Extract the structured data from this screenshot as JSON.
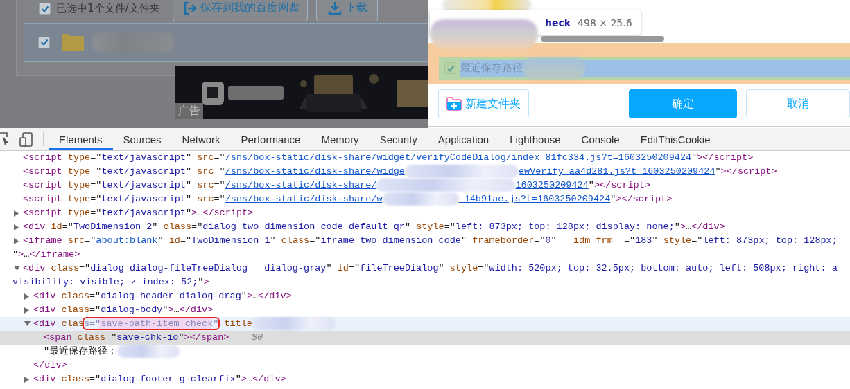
{
  "page": {
    "select_all": {
      "label": "已选中1个文件/文件夹",
      "checked": true
    },
    "buttons": [
      {
        "label": "保存到我的百度网盘",
        "kind": "save"
      },
      {
        "label": "下载",
        "kind": "download"
      }
    ],
    "files": [
      {
        "kind": "folder",
        "checked": true
      }
    ],
    "ad": {
      "kind": "picture",
      "label": "广告"
    }
  },
  "dialog": {
    "tooltip": {
      "name": "heck",
      "size": "498 × 25.6"
    },
    "save_path": {
      "label": "最近保存路径",
      "checked": true
    },
    "buttons": [
      {
        "label": "新建文件夹",
        "kind": "new-folder"
      },
      {
        "label": "确定",
        "kind": "primary"
      },
      {
        "label": "取消",
        "kind": "secondary"
      }
    ]
  },
  "devtools": {
    "tabs": [
      {
        "label": "Elements",
        "selected": true
      },
      {
        "label": "Sources",
        "selected": false
      },
      {
        "label": "Network",
        "selected": false
      },
      {
        "label": "Performance",
        "selected": false
      },
      {
        "label": "Memory",
        "selected": false
      },
      {
        "label": "Security",
        "selected": false
      },
      {
        "label": "Application",
        "selected": false
      },
      {
        "label": "Lighthouse",
        "selected": false
      },
      {
        "label": "Console",
        "selected": false
      },
      {
        "label": "EditThisCookie",
        "selected": false
      }
    ],
    "tree": [
      {
        "selected": false,
        "hovered": false,
        "lines": [
          [
            {
              "kind": "tag",
              "text": "<script"
            },
            {
              "kind": "attr",
              "text": " type"
            },
            {
              "kind": "text",
              "text": "=\""
            },
            {
              "kind": "value",
              "text": "text/javascript"
            },
            {
              "kind": "text",
              "text": "\""
            },
            {
              "kind": "attr",
              "text": " src"
            },
            {
              "kind": "text",
              "text": "=\""
            },
            {
              "kind": "link",
              "text": "/sns/box-static/disk-share/widget/verifyCodeDialog/index_81fc334.js?t=1603250209424"
            },
            {
              "kind": "text",
              "text": "\""
            },
            {
              "kind": "tag",
              "text": "></script>"
            }
          ]
        ]
      },
      {
        "selected": false,
        "hovered": false,
        "lines": [
          [
            {
              "kind": "tag",
              "text": "<script"
            },
            {
              "kind": "attr",
              "text": " type"
            },
            {
              "kind": "text",
              "text": "=\""
            },
            {
              "kind": "value",
              "text": "text/javascript"
            },
            {
              "kind": "text",
              "text": "\""
            },
            {
              "kind": "attr",
              "text": " src"
            },
            {
              "kind": "text",
              "text": "=\""
            },
            {
              "kind": "link",
              "text": "/sns/box-static/disk-share/widge"
            },
            {
              "kind": "redacted"
            },
            {
              "kind": "link",
              "text": "ewVerify_aa4d281.js?t=1603250209424"
            },
            {
              "kind": "text",
              "text": "\""
            },
            {
              "kind": "tag",
              "text": "></script>"
            }
          ]
        ]
      },
      {
        "selected": false,
        "hovered": false,
        "lines": [
          [
            {
              "kind": "tag",
              "text": "<script"
            },
            {
              "kind": "attr",
              "text": " type"
            },
            {
              "kind": "text",
              "text": "=\""
            },
            {
              "kind": "value",
              "text": "text/javascript"
            },
            {
              "kind": "text",
              "text": "\""
            },
            {
              "kind": "attr",
              "text": " src"
            },
            {
              "kind": "text",
              "text": "=\""
            },
            {
              "kind": "link",
              "text": "/sns/box-static/disk-share/"
            },
            {
              "kind": "redacted"
            },
            {
              "kind": "link",
              "text": "1603250209424"
            },
            {
              "kind": "text",
              "text": "\""
            },
            {
              "kind": "tag",
              "text": "></script>"
            }
          ]
        ]
      },
      {
        "selected": false,
        "hovered": false,
        "lines": [
          [
            {
              "kind": "tag",
              "text": "<script"
            },
            {
              "kind": "attr",
              "text": " type"
            },
            {
              "kind": "text",
              "text": "=\""
            },
            {
              "kind": "value",
              "text": "text/javascript"
            },
            {
              "kind": "text",
              "text": "\""
            },
            {
              "kind": "attr",
              "text": " src"
            },
            {
              "kind": "text",
              "text": "=\""
            },
            {
              "kind": "link",
              "text": "/sns/box-static/disk-share/w"
            },
            {
              "kind": "redacted"
            },
            {
              "kind": "link",
              "text": "_14b91ae.js?t=1603250209424"
            },
            {
              "kind": "text",
              "text": "\""
            },
            {
              "kind": "tag",
              "text": "></script>"
            }
          ]
        ]
      },
      {
        "expanded": false,
        "selected": false,
        "hovered": false,
        "lines": [
          [
            {
              "kind": "tag",
              "text": "<script"
            },
            {
              "kind": "attr",
              "text": " type"
            },
            {
              "kind": "text",
              "text": "=\""
            },
            {
              "kind": "value",
              "text": "text/javascript"
            },
            {
              "kind": "text",
              "text": "\""
            },
            {
              "kind": "tag",
              "text": ">"
            },
            {
              "kind": "text",
              "text": "…"
            },
            {
              "kind": "tag",
              "text": "</script>"
            }
          ]
        ]
      },
      {
        "expanded": false,
        "selected": false,
        "hovered": false,
        "lines": [
          [
            {
              "kind": "tag",
              "text": "<div"
            },
            {
              "kind": "attr",
              "text": " id"
            },
            {
              "kind": "text",
              "text": "=\""
            },
            {
              "kind": "value",
              "text": "TwoDimension_2"
            },
            {
              "kind": "text",
              "text": "\""
            },
            {
              "kind": "attr",
              "text": " class"
            },
            {
              "kind": "text",
              "text": "=\""
            },
            {
              "kind": "value",
              "text": "dialog_two_dimension_code default_qr"
            },
            {
              "kind": "text",
              "text": "\""
            },
            {
              "kind": "attr",
              "text": " style"
            },
            {
              "kind": "text",
              "text": "=\""
            },
            {
              "kind": "value",
              "text": "left: 873px; top: 128px; display: none;"
            },
            {
              "kind": "text",
              "text": "\""
            },
            {
              "kind": "tag",
              "text": ">"
            },
            {
              "kind": "text",
              "text": "…"
            },
            {
              "kind": "tag",
              "text": "</div>"
            }
          ]
        ]
      },
      {
        "expanded": false,
        "selected": false,
        "hovered": false,
        "lines": [
          [
            {
              "kind": "tag",
              "text": "<iframe"
            },
            {
              "kind": "attr",
              "text": " src"
            },
            {
              "kind": "text",
              "text": "=\""
            },
            {
              "kind": "link",
              "text": "about:blank"
            },
            {
              "kind": "text",
              "text": "\""
            },
            {
              "kind": "attr",
              "text": " id"
            },
            {
              "kind": "text",
              "text": "=\""
            },
            {
              "kind": "value",
              "text": "TwoDimension_1"
            },
            {
              "kind": "text",
              "text": "\""
            },
            {
              "kind": "attr",
              "text": " class"
            },
            {
              "kind": "text",
              "text": "=\""
            },
            {
              "kind": "value",
              "text": "iframe_two_dimension_code"
            },
            {
              "kind": "text",
              "text": "\""
            },
            {
              "kind": "attr",
              "text": " frameborder"
            },
            {
              "kind": "text",
              "text": "=\""
            },
            {
              "kind": "value",
              "text": "0"
            },
            {
              "kind": "text",
              "text": "\""
            },
            {
              "kind": "attr",
              "text": " __idm_frm__"
            },
            {
              "kind": "text",
              "text": "=\""
            },
            {
              "kind": "value",
              "text": "183"
            },
            {
              "kind": "text",
              "text": "\""
            },
            {
              "kind": "attr",
              "text": " style"
            },
            {
              "kind": "text",
              "text": "=\""
            },
            {
              "kind": "value",
              "text": "left: 873px; top: 128px;"
            }
          ],
          [
            {
              "kind": "text",
              "text": "\""
            },
            {
              "kind": "tag",
              "text": ">"
            },
            {
              "kind": "text",
              "text": "…"
            },
            {
              "kind": "tag",
              "text": "</iframe>"
            }
          ]
        ]
      },
      {
        "expanded": true,
        "selected": false,
        "hovered": false,
        "lines": [
          [
            {
              "kind": "tag",
              "text": "<div"
            },
            {
              "kind": "attr",
              "text": " class"
            },
            {
              "kind": "text",
              "text": "=\""
            },
            {
              "kind": "value",
              "text": "dialog dialog-fileTreeDialog   dialog-gray"
            },
            {
              "kind": "text",
              "text": "\""
            },
            {
              "kind": "attr",
              "text": " id"
            },
            {
              "kind": "text",
              "text": "=\""
            },
            {
              "kind": "value",
              "text": "fileTreeDialog"
            },
            {
              "kind": "text",
              "text": "\""
            },
            {
              "kind": "attr",
              "text": " style"
            },
            {
              "kind": "text",
              "text": "=\""
            },
            {
              "kind": "value",
              "text": "width: 520px; top: 32.5px; bottom: auto; left: 508px; right: a"
            }
          ],
          [
            {
              "kind": "value",
              "text": "visibility: visible; z-index: 52;"
            },
            {
              "kind": "text",
              "text": "\""
            },
            {
              "kind": "tag",
              "text": ">"
            }
          ]
        ],
        "children": [
          {
            "expanded": false,
            "selected": false,
            "hovered": false,
            "lines": [
              [
                {
                  "kind": "tag",
                  "text": "<div"
                },
                {
                  "kind": "attr",
                  "text": " class"
                },
                {
                  "kind": "text",
                  "text": "=\""
                },
                {
                  "kind": "value",
                  "text": "dialog-header dialog-drag"
                },
                {
                  "kind": "text",
                  "text": "\""
                },
                {
                  "kind": "tag",
                  "text": ">"
                },
                {
                  "kind": "text",
                  "text": "…"
                },
                {
                  "kind": "tag",
                  "text": "</div>"
                }
              ]
            ]
          },
          {
            "expanded": false,
            "selected": false,
            "hovered": false,
            "lines": [
              [
                {
                  "kind": "tag",
                  "text": "<div"
                },
                {
                  "kind": "attr",
                  "text": " class"
                },
                {
                  "kind": "text",
                  "text": "=\""
                },
                {
                  "kind": "value",
                  "text": "dialog-body"
                },
                {
                  "kind": "text",
                  "text": "\""
                },
                {
                  "kind": "tag",
                  "text": ">"
                },
                {
                  "kind": "text",
                  "text": "…"
                },
                {
                  "kind": "tag",
                  "text": "</div>"
                }
              ]
            ]
          },
          {
            "expanded": true,
            "selected": false,
            "hovered": true,
            "lines": [
              [
                {
                  "kind": "tag",
                  "text": "<div"
                },
                {
                  "kind": "attr",
                  "text": " clas"
                },
                {
                  "kind": "marked",
                  "text": "s=\"save-path-item check\""
                },
                {
                  "kind": "attr",
                  "text": " title"
                },
                {
                  "kind": "redacted"
                }
              ]
            ],
            "children": [
              {
                "selected": true,
                "hovered": false,
                "lines": [
                  [
                    {
                      "kind": "tag",
                      "text": "<span"
                    },
                    {
                      "kind": "attr",
                      "text": " class"
                    },
                    {
                      "kind": "text",
                      "text": "=\""
                    },
                    {
                      "kind": "value",
                      "text": "save-chk-io"
                    },
                    {
                      "kind": "text",
                      "text": "\""
                    },
                    {
                      "kind": "tag",
                      "text": "></span>"
                    },
                    {
                      "kind": "hint",
                      "text": " == $0"
                    }
                  ]
                ]
              },
              {
                "selected": false,
                "hovered": false,
                "lines": [
                  [
                    {
                      "kind": "text",
                      "text": "\"最近保存路径："
                    },
                    {
                      "kind": "redacted"
                    }
                  ]
                ]
              }
            ],
            "closing": [
              {
                "kind": "tag",
                "text": "</div>"
              }
            ]
          },
          {
            "expanded": false,
            "selected": false,
            "hovered": false,
            "lines": [
              [
                {
                  "kind": "tag",
                  "text": "<div"
                },
                {
                  "kind": "attr",
                  "text": " class"
                },
                {
                  "kind": "text",
                  "text": "=\""
                },
                {
                  "kind": "value",
                  "text": "dialog-footer g-clearfix"
                },
                {
                  "kind": "text",
                  "text": "\""
                },
                {
                  "kind": "tag",
                  "text": ">"
                },
                {
                  "kind": "text",
                  "text": "…"
                },
                {
                  "kind": "tag",
                  "text": "</div>"
                }
              ]
            ]
          }
        ]
      }
    ]
  }
}
